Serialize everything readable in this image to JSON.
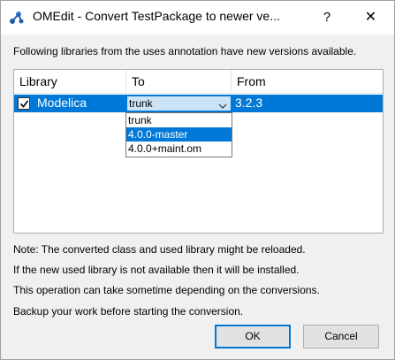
{
  "window": {
    "title": "OMEdit - Convert TestPackage to newer ve...",
    "help_glyph": "?",
    "close_glyph": "✕",
    "app_icon": "omedit-logo-icon"
  },
  "heading": "Following libraries from the uses annotation have new versions available.",
  "table": {
    "columns": [
      "Library",
      "To",
      "From"
    ],
    "rows": [
      {
        "checked": true,
        "library": "Modelica",
        "to": "trunk",
        "from": "3.2.3"
      }
    ]
  },
  "dropdown": {
    "options": [
      "trunk",
      "4.0.0-master",
      "4.0.0+maint.om"
    ],
    "highlighted_index": 1
  },
  "notes": [
    "Note: The converted class and used library might be reloaded.",
    "If the new used library is not available then it will be installed.",
    "This operation can take sometime depending on the conversions.",
    "Backup your work before starting the conversion."
  ],
  "buttons": {
    "ok": "OK",
    "cancel": "Cancel"
  },
  "colors": {
    "selection": "#0078d7",
    "combo_bg": "#cce4f7"
  }
}
